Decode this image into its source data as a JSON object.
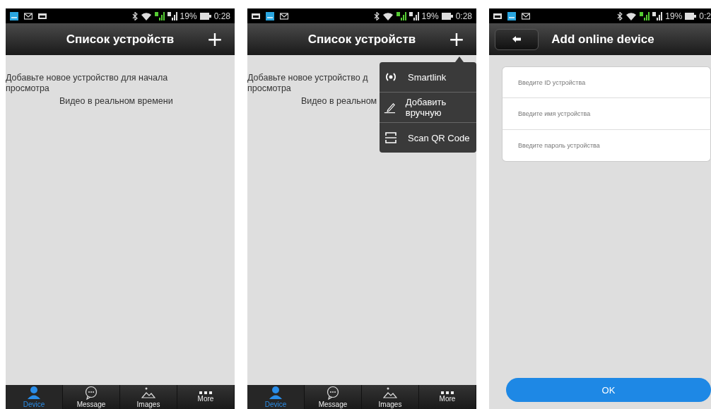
{
  "screens": [
    {
      "kind": "device_list",
      "status_bar": {
        "notifications": [
          {
            "kind": "app"
          },
          {
            "kind": "mail"
          },
          {
            "kind": "image"
          }
        ],
        "battery": "19%",
        "time": "0:28"
      },
      "header": {
        "title": "Список устройств",
        "action": "+"
      },
      "empty_message": "Добавьте новое устройство для начала просмотра",
      "subtitle": "Видео в реальном времени",
      "tabs": [
        {
          "label": "Device",
          "selected": true
        },
        {
          "label": "Message",
          "selected": false
        },
        {
          "label": "Images",
          "selected": false
        },
        {
          "label": "More",
          "selected": false
        }
      ]
    },
    {
      "kind": "device_list",
      "status_bar": {
        "notifications": [
          {
            "kind": "image"
          },
          {
            "kind": "app"
          },
          {
            "kind": "mail"
          }
        ],
        "battery": "19%",
        "time": "0:28"
      },
      "header": {
        "title": "Список устройств",
        "action": "+"
      },
      "empty_message": [
        "Добавьте новое устройство д",
        "просмотра"
      ],
      "subtitle": "Видео в реальном",
      "menu": [
        {
          "label": "Smartlink"
        },
        {
          "label": "Добавить вручную"
        },
        {
          "label": "Scan QR Code"
        }
      ],
      "tabs": [
        {
          "label": "Device",
          "selected": true
        },
        {
          "label": "Message",
          "selected": false
        },
        {
          "label": "Images",
          "selected": false
        },
        {
          "label": "More",
          "selected": false
        }
      ]
    },
    {
      "kind": "add_form",
      "status_bar": {
        "notifications": [
          {
            "kind": "image"
          },
          {
            "kind": "app"
          },
          {
            "kind": "mail"
          }
        ],
        "battery": "19%",
        "time": "0:2"
      },
      "header": {
        "title": "Add online device"
      },
      "fields": [
        {
          "placeholder": "Введите ID устройства"
        },
        {
          "placeholder": "Введите имя устройства"
        },
        {
          "placeholder": "Введите пароль устройства"
        }
      ],
      "ok_button": "OK"
    }
  ]
}
